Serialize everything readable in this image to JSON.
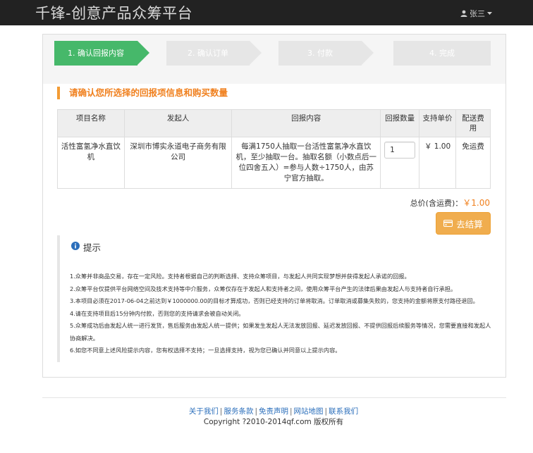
{
  "navbar": {
    "brand": "千锋-创意产品众筹平台",
    "user_name": "张三"
  },
  "steps": [
    {
      "label": "1. 确认回报内容",
      "active": true
    },
    {
      "label": "2. 确认订单",
      "active": false
    },
    {
      "label": "3. 付款",
      "active": false
    },
    {
      "label": "4. 完成",
      "active": false
    }
  ],
  "section_title": "请确认您所选择的回报项信息和购买数量",
  "table": {
    "headers": [
      "项目名称",
      "发起人",
      "回报内容",
      "回报数量",
      "支持单价",
      "配送费用"
    ],
    "row": {
      "project_name": "活性富氢净水直饮机",
      "initiator": "深圳市博实永道电子商务有限公司",
      "reward_content": "每满1750人抽取一台活性富氢净水直饮机，至少抽取一台。抽取名额（小数点后一位四舍五入）=参与人数÷1750人，由苏宁官方抽取。",
      "quantity": "1",
      "unit_price": "￥ 1.00",
      "shipping": "免运费"
    }
  },
  "total": {
    "label": "总价(含运费)：",
    "amount": "￥1.00"
  },
  "checkout_label": "去结算",
  "tips": {
    "title": "提示",
    "items": [
      "1.众筹并非商品交易，存在一定风险。支持者根据自己的判断选择、支持众筹项目，与发起人共同实现梦想并获得发起人承诺的回报。",
      "2.众筹平台仅提供平台网络空间及技术支持等中介服务，众筹仅存在于发起人和支持者之间，使用众筹平台产生的法律后果由发起人与支持者自行承担。",
      "3.本项目必须在2017-06-04之前达到￥1000000.00的目标才算成功，否则已经支持的订单将取消。订单取消或募集失败的，您支持的金额将原支付路径退回。",
      "4.请在支持项目后15分钟内付款，否则您的支持请求会被自动关闭。",
      "5.众筹成功后由发起人统一进行发货，售后服务由发起人统一提供；如果发生发起人无法发放回报、延迟发放回报、不提供回报后续服务等情况，您需要直接和发起人协商解决。",
      "6.如您不同意上述风险提示内容，您有权选择不支持；一旦选择支持，视为您已确认并同意以上提示内容。"
    ]
  },
  "footer": {
    "links": [
      "关于我们",
      "服务条款",
      "免责声明",
      "网站地图",
      "联系我们"
    ],
    "copyright": "Copyright ?2010-2014qf.com 版权所有"
  },
  "colors": {
    "navbar_bg": "#222222",
    "step_active": "#46b86a",
    "step_inactive": "#e6e6e6",
    "accent_orange": "#f0801e",
    "button_orange": "#f0ad4e",
    "link_blue": "#2a6ebb",
    "price_red": "#e64a19"
  }
}
